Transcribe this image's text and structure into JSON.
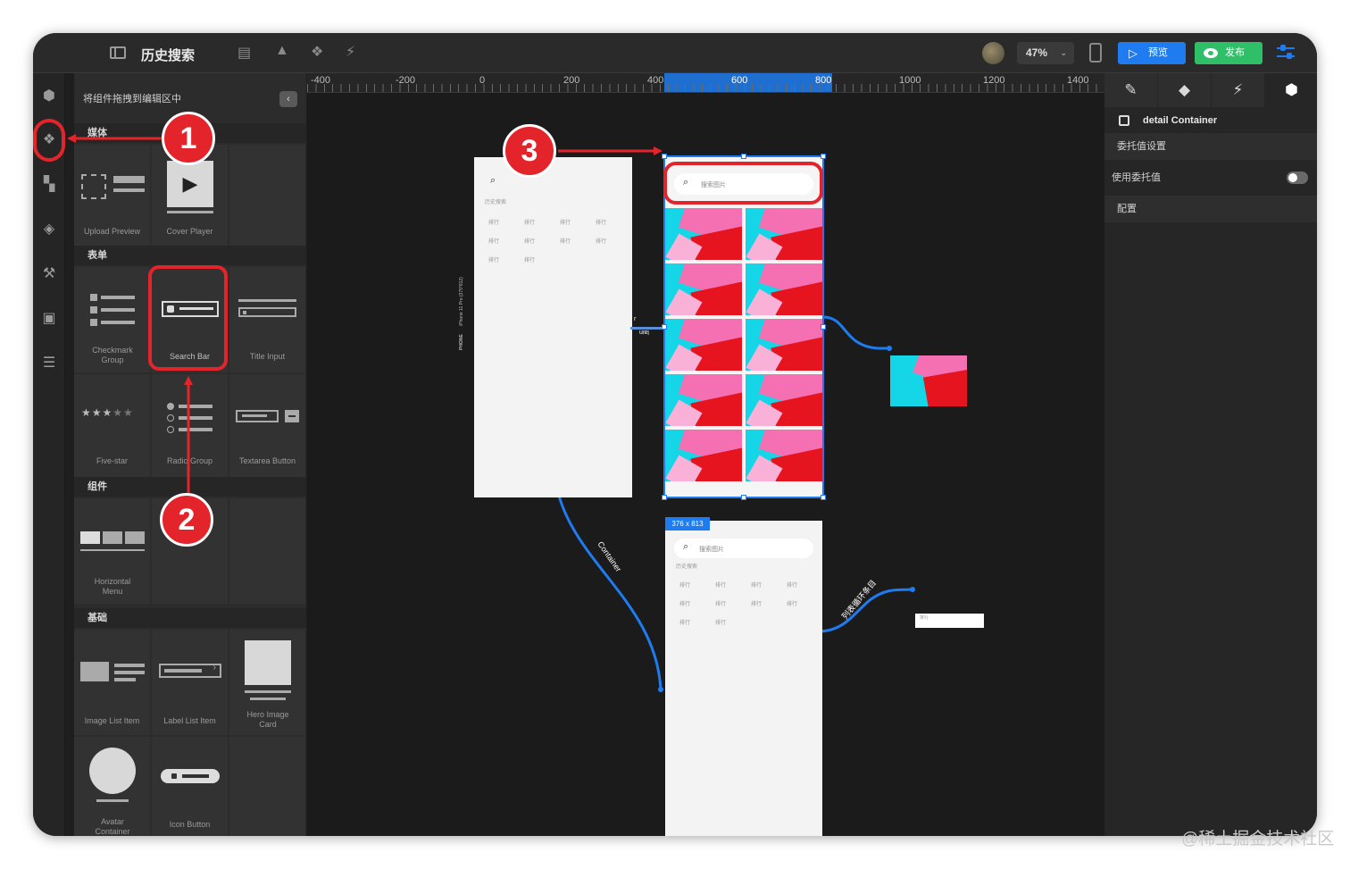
{
  "header": {
    "title": "历史搜索",
    "zoom": "47%",
    "preview_label": "预览",
    "publish_label": "发布"
  },
  "panel": {
    "drag_hint": "将组件拖拽到编辑区中",
    "sections": {
      "media": "媒体",
      "form": "表单",
      "component": "组件",
      "basic": "基础"
    },
    "items": {
      "upload_preview": "Upload Preview",
      "cover_player": "Cover Player",
      "checkmark_group": "Checkmark Group",
      "search_bar": "Search Bar",
      "title_input": "Title Input",
      "five_star": "Five-star",
      "radio_group": "Radio Group",
      "textarea_button": "Textarea Button",
      "horizontal_menu": "Horizontal Menu",
      "image_list_item": "Image List Item",
      "label_list_item": "Label List Item",
      "hero_image_card": "Hero Image Card",
      "avatar_container": "Avatar Container",
      "icon_button": "Icon Button"
    }
  },
  "ruler": {
    "ticks": [
      "-400",
      "-200",
      "0",
      "200",
      "400",
      "600",
      "800",
      "1000",
      "1200",
      "1400"
    ],
    "selected_name": "detail Container"
  },
  "canvas": {
    "screen1_history_label": "历史搜索",
    "screen1_side_label": "iPhone 11 Pro (375*812)",
    "screen1_device": "PHONE",
    "screen1_tag_text": "排行",
    "search_placeholder": "搜索图片",
    "screen3_size_badge": "376 x 813",
    "screen3_history_label": "历史搜索",
    "screen3_tag_text": "排行",
    "connector_container_label": "Container",
    "connector_list_label": "列表循环条目",
    "list_item_tag_text": "排行",
    "small_label_left": "r",
    "small_label_right": "lain"
  },
  "right_panel": {
    "item_name": "detail Container",
    "delegate_settings": "委托值设置",
    "use_delegate": "使用委托值",
    "config": "配置"
  },
  "callouts": [
    "1",
    "2",
    "3"
  ],
  "watermark": "@稀土掘金技术社区",
  "colors": {
    "accent_blue": "#1e7cf0",
    "publish_green": "#2fbf68",
    "callout_red": "#e3242b",
    "photo_pink": "#f56fb3",
    "photo_cyan": "#14d6e6",
    "photo_red": "#e6141e"
  }
}
